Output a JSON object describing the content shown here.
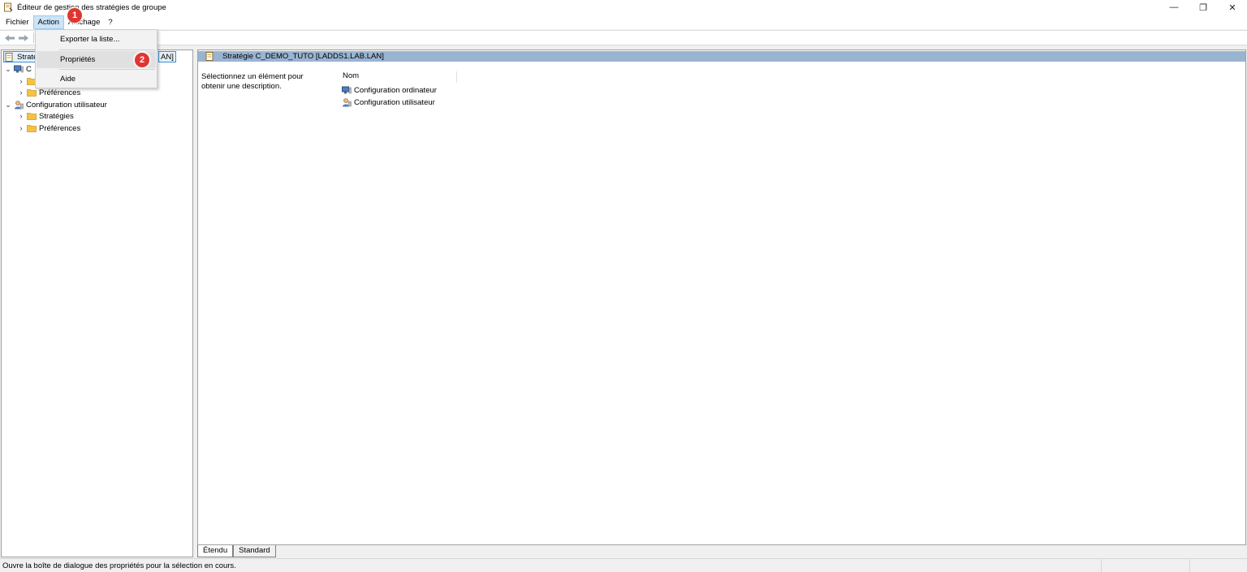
{
  "window": {
    "title": "Éditeur de gestion des stratégies de groupe",
    "controls": {
      "minimize": "—",
      "restore": "❐",
      "close": "✕"
    }
  },
  "menubar": {
    "items": [
      "Fichier",
      "Action",
      "Affichage",
      "?"
    ],
    "active": "Action"
  },
  "dropdown": {
    "items": [
      "Exporter la liste...",
      "Propriétés",
      "Aide"
    ],
    "highlighted": "Propriétés"
  },
  "tree": {
    "root_left": "Strate",
    "root_right": "AN]",
    "computer_config_partial": "C",
    "computer_prefs": "Préférences",
    "user_config": "Configuration utilisateur",
    "user_strategies": "Stratégies",
    "user_prefs": "Préférences"
  },
  "right": {
    "header": "Stratégie C_DEMO_TUTO [LADDS1.LAB.LAN]",
    "description": "Sélectionnez un élément pour obtenir une description.",
    "column_name": "Nom",
    "items": [
      "Configuration ordinateur",
      "Configuration utilisateur"
    ]
  },
  "tabs": [
    "Étendu",
    "Standard"
  ],
  "status": "Ouvre la boîte de dialogue des propriétés pour la sélection en cours.",
  "annotations": [
    "1",
    "2"
  ],
  "colors": {
    "header_band": "#99b4d1",
    "badge": "#e03530",
    "menu_active": "#cce4f7",
    "folder": "#f5c242"
  },
  "icons": {
    "app": "gpo-editor-icon",
    "back": "back-arrow-icon",
    "forward": "forward-arrow-icon",
    "folder": "folder-icon",
    "computer": "computer-icon",
    "user": "user-icon"
  }
}
